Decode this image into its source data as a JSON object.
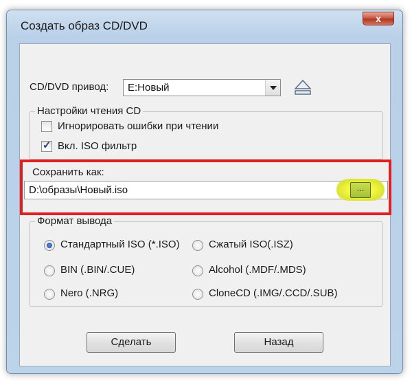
{
  "window": {
    "title": "Создать образ CD/DVD",
    "close_label": "x"
  },
  "drive": {
    "label": "CD/DVD привод:",
    "selected": "E:Новый"
  },
  "read_settings": {
    "legend": "Настройки чтения CD",
    "options": [
      {
        "label": "Игнорировать ошибки при чтении",
        "checked": false
      },
      {
        "label": "Вкл. ISO фильтр",
        "checked": true
      }
    ]
  },
  "save_as": {
    "label": "Сохранить как:",
    "value": "D:\\образы\\Новый.iso",
    "browse_label": "..."
  },
  "output_format": {
    "legend": "Формат вывода",
    "options": [
      {
        "label": "Стандартный ISO (*.ISO)",
        "checked": true
      },
      {
        "label": "Сжатый ISO(.ISZ)",
        "checked": false
      },
      {
        "label": "BIN (.BIN/.CUE)",
        "checked": false
      },
      {
        "label": "Alcohol (.MDF/.MDS)",
        "checked": false
      },
      {
        "label": "Nero (.NRG)",
        "checked": false
      },
      {
        "label": "CloneCD (.IMG/.CCD/.SUB)",
        "checked": false
      }
    ]
  },
  "buttons": {
    "make": "Сделать",
    "back": "Назад"
  },
  "colors": {
    "highlight": "#e02020",
    "browse_glow": "#f5f542"
  }
}
